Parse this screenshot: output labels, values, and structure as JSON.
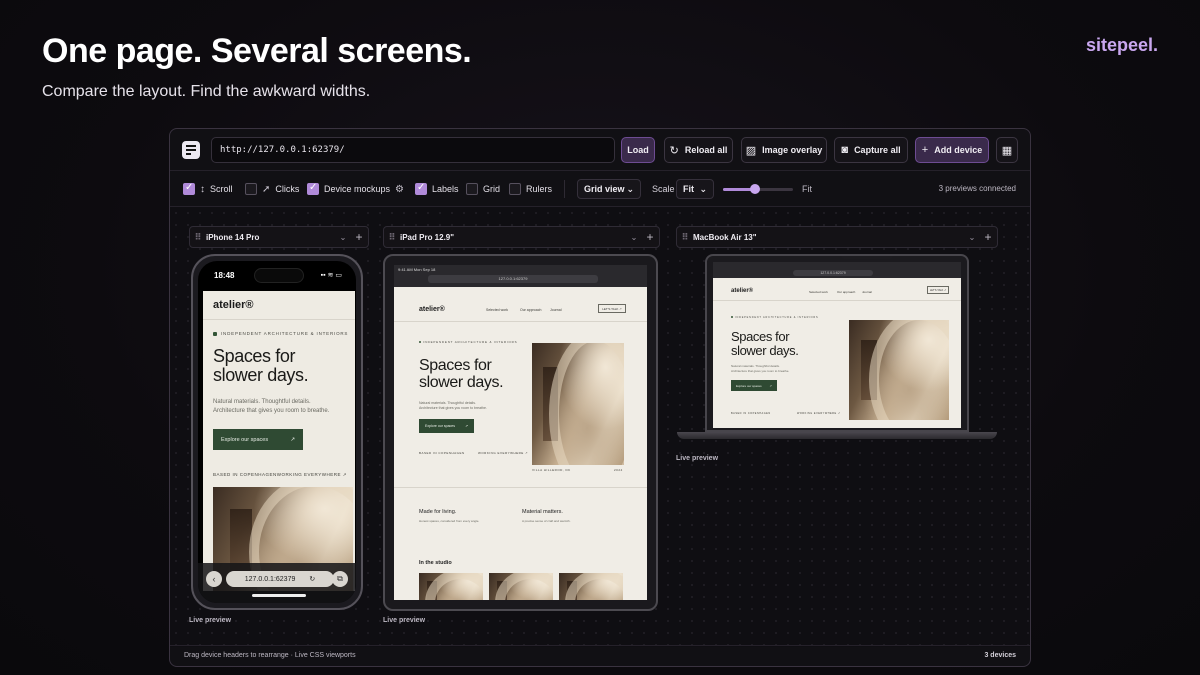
{
  "hero": {
    "title": "One page. Several screens.",
    "subtitle": "Compare the layout. Find the awkward widths.",
    "brand": "sitepeel."
  },
  "toolbar": {
    "url_value": "http://127.0.0.1:62379/",
    "load_label": "Load",
    "reload_label": "Reload all",
    "overlay_label": "Image overlay",
    "capture_label": "Capture all",
    "add_label": "Add device"
  },
  "options": {
    "scroll": {
      "label": "Scroll",
      "checked": true
    },
    "clicks": {
      "label": "Clicks",
      "checked": false
    },
    "mockups": {
      "label": "Device mockups",
      "checked": true
    },
    "labels": {
      "label": "Labels",
      "checked": true
    },
    "grid": {
      "label": "Grid",
      "checked": false
    },
    "rulers": {
      "label": "Rulers",
      "checked": false
    },
    "view_mode": "Grid view",
    "scale_label": "Scale",
    "scale_value": "Fit",
    "slider_value": 0.45,
    "fit_label": "Fit",
    "connected": "3 previews connected"
  },
  "devices": [
    {
      "name": "iPhone 14 Pro",
      "live": "Live preview"
    },
    {
      "name": "iPad Pro 12.9\"",
      "live": "Live preview"
    },
    {
      "name": "MacBook Air 13\"",
      "live": "Live preview"
    }
  ],
  "site": {
    "logo": "atelier®",
    "eyebrow": "INDEPENDENT ARCHITECTURE & INTERIORS",
    "headline_1": "Spaces for",
    "headline_2": "slower days.",
    "body_1": "Natural materials. Thoughtful details.",
    "body_2": "Architecture that gives you room to breathe.",
    "cta": "Explore our spaces",
    "cta_arrow": "↗",
    "meta_left": "BASED IN COPENHAGEN",
    "meta_right": "WORKING EVERYWHERE ↗",
    "nav": [
      "Selected work",
      "Our approach",
      "Journal"
    ],
    "nav_button": "LET'S TALK ↗",
    "feature_1_title": "Made for living.",
    "feature_1_body": "Honest spaces, considered from every angle.",
    "feature_2_title": "Material matters.",
    "feature_2_body": "A precise sense of craft and warmth.",
    "studio_title": "In the studio",
    "caption": "VILLA HILLEROD, DK",
    "caption_year": "2024"
  },
  "phone": {
    "time": "18:48",
    "status_right": "▪▪ ≋ ▭",
    "url": "127.0.0.1:62379",
    "back": "‹",
    "reload": "↻",
    "tabs": "⧉"
  },
  "tablet": {
    "time": "9:41 AM  Mon Sep 18",
    "url": "127.0.0.1:62379"
  },
  "laptop": {
    "url": "127.0.0.1:62379"
  },
  "statusbar": {
    "hint": "Drag device headers to rearrange · Live CSS viewports",
    "count": "3 devices"
  },
  "colors": {
    "accent": "#b08ad9",
    "brand": "#c9a7ef",
    "cta_green": "#2f4a33",
    "page_bg": "#eeebe3"
  }
}
